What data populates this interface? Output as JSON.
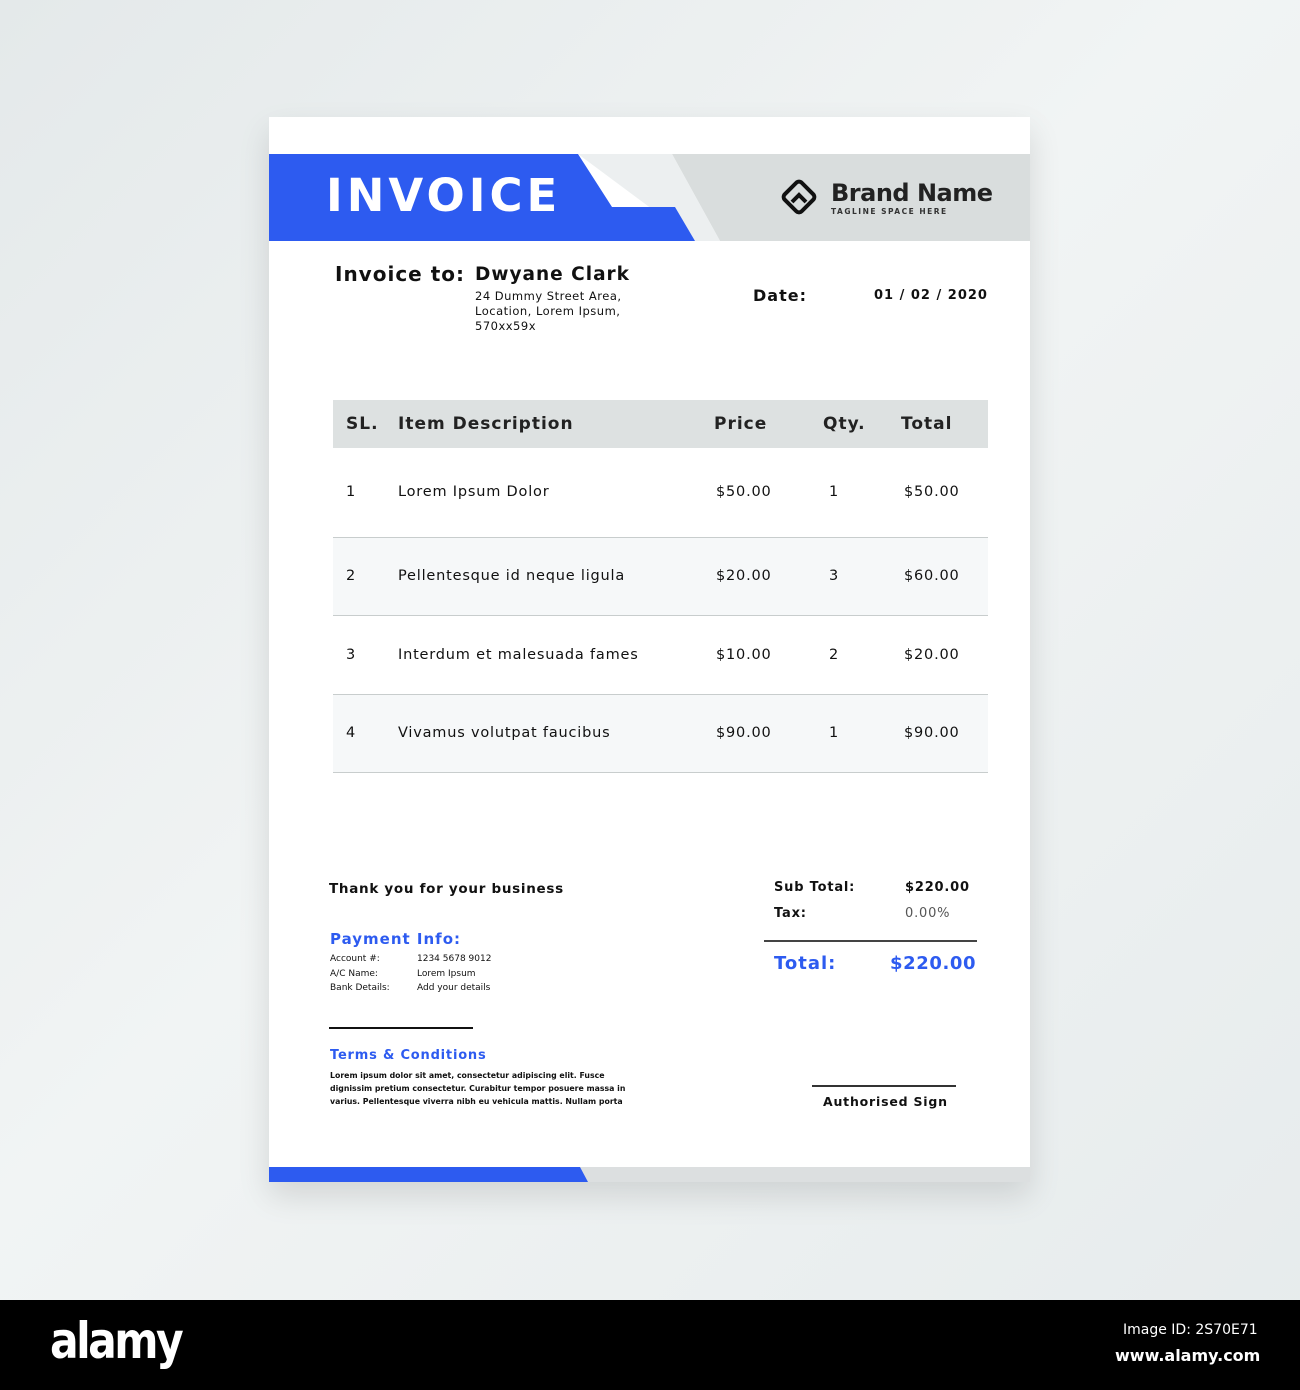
{
  "header": {
    "title": "INVOICE",
    "brand_name": "Brand Name",
    "tagline": "TAGLINE SPACE HERE"
  },
  "billing": {
    "label": "Invoice to:",
    "name": "Dwyane Clark",
    "address": [
      "24 Dummy Street Area,",
      "Location, Lorem Ipsum,",
      "570xx59x"
    ],
    "date_label": "Date:",
    "date": "01 / 02 / 2020"
  },
  "table": {
    "headers": [
      "SL.",
      "Item Description",
      "Price",
      "Qty.",
      "Total"
    ],
    "rows": [
      {
        "sl": "1",
        "desc": "Lorem Ipsum Dolor",
        "price": "$50.00",
        "qty": "1",
        "total": "$50.00"
      },
      {
        "sl": "2",
        "desc": "Pellentesque id neque ligula",
        "price": "$20.00",
        "qty": "3",
        "total": "$60.00"
      },
      {
        "sl": "3",
        "desc": "Interdum et malesuada fames",
        "price": "$10.00",
        "qty": "2",
        "total": "$20.00"
      },
      {
        "sl": "4",
        "desc": "Vivamus volutpat faucibus",
        "price": "$90.00",
        "qty": "1",
        "total": "$90.00"
      }
    ]
  },
  "thanks": "Thank you for your business",
  "payment": {
    "title": "Payment Info:",
    "rows": [
      {
        "k": "Account #:",
        "v": "1234 5678 9012"
      },
      {
        "k": "A/C Name:",
        "v": "Lorem Ipsum"
      },
      {
        "k": "Bank Details:",
        "v": "Add your details"
      }
    ]
  },
  "terms": {
    "title": "Terms & Conditions",
    "lines": [
      "Lorem ipsum dolor sit amet, consectetur adipiscing elit. Fusce",
      "dignissim pretium consectetur. Curabitur tempor posuere massa in",
      "varius. Pellentesque viverra nibh eu vehicula mattis. Nullam porta"
    ]
  },
  "totals": {
    "sub_label": "Sub Total:",
    "sub": "$220.00",
    "tax_label": "Tax:",
    "tax": "0.00%",
    "total_label": "Total:",
    "total": "$220.00"
  },
  "sign": "Authorised Sign",
  "colors": {
    "accent": "#2d5bf0",
    "band": "#d9dddd"
  },
  "stock": {
    "logo": "alamy",
    "image_id": "Image ID: 2S70E71",
    "site": "www.alamy.com"
  }
}
